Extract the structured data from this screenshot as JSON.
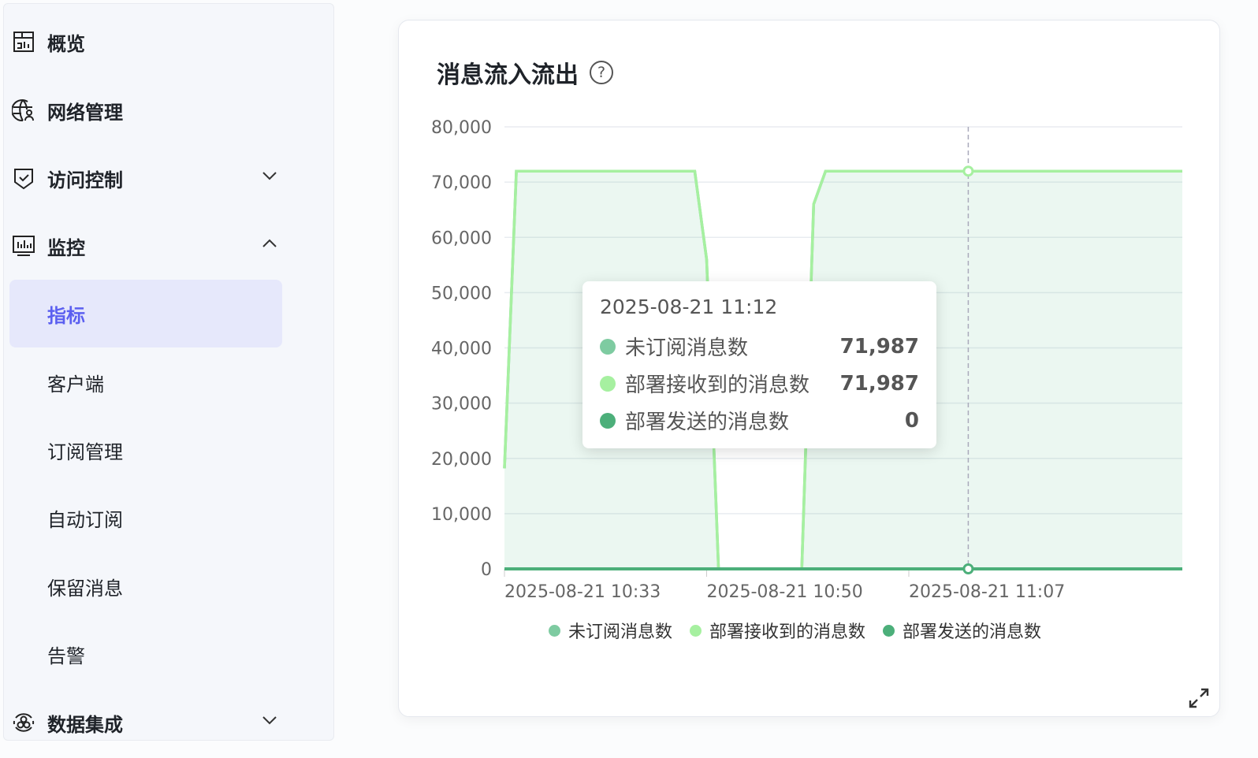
{
  "sidebar": {
    "items": [
      {
        "label": "概览",
        "icon": "dashboard-icon"
      },
      {
        "label": "网络管理",
        "icon": "globe-user-icon"
      },
      {
        "label": "访问控制",
        "icon": "shield-check-icon",
        "chevron": "down"
      },
      {
        "label": "监控",
        "icon": "monitor-chart-icon",
        "chevron": "up"
      },
      {
        "label": "指标",
        "active": true
      },
      {
        "label": "客户端"
      },
      {
        "label": "订阅管理"
      },
      {
        "label": "自动订阅"
      },
      {
        "label": "保留消息"
      },
      {
        "label": "告警"
      },
      {
        "label": "数据集成",
        "icon": "integration-icon",
        "chevron": "down"
      }
    ]
  },
  "card": {
    "title": "消息流入流出",
    "help_icon": "?"
  },
  "tooltip": {
    "time": "2025-08-21 11:12",
    "rows": [
      {
        "label": "未订阅消息数",
        "value": "71,987",
        "color": "#7ecba1"
      },
      {
        "label": "部署接收到的消息数",
        "value": "71,987",
        "color": "#a6f0a0"
      },
      {
        "label": "部署发送的消息数",
        "value": "0",
        "color": "#4caf7a"
      }
    ]
  },
  "chart_data": {
    "type": "area",
    "title": "消息流入流出",
    "ylim": [
      0,
      80000
    ],
    "yticks": [
      "0",
      "10,000",
      "20,000",
      "30,000",
      "40,000",
      "50,000",
      "60,000",
      "70,000",
      "80,000"
    ],
    "xtick_labels": [
      "2025-08-21 10:33",
      "2025-08-21 10:50",
      "2025-08-21 11:07"
    ],
    "x_start": "10:33",
    "x_step_minutes": 1,
    "series": [
      {
        "name": "未订阅消息数",
        "color": "#7ecba1",
        "values": [
          18200,
          71987,
          71987,
          71987,
          71987,
          71987,
          71987,
          71987,
          71987,
          71987,
          71987,
          71987,
          71987,
          71987,
          71987,
          71987,
          71987,
          56000,
          0,
          0,
          0,
          0,
          0,
          0,
          0,
          0,
          66000,
          71987,
          71987,
          71987,
          71987,
          71987,
          71987,
          71987,
          71987,
          71987,
          71987,
          71987,
          71987,
          71987,
          71987,
          71987,
          71987,
          71987,
          71987,
          71987,
          71987,
          71987,
          71987,
          71987,
          71987,
          71987,
          71987,
          71987,
          71987,
          71987,
          71987,
          71987
        ]
      },
      {
        "name": "部署接收到的消息数",
        "color": "#a6f0a0",
        "values": [
          18200,
          71987,
          71987,
          71987,
          71987,
          71987,
          71987,
          71987,
          71987,
          71987,
          71987,
          71987,
          71987,
          71987,
          71987,
          71987,
          71987,
          56000,
          0,
          0,
          0,
          0,
          0,
          0,
          0,
          0,
          66000,
          71987,
          71987,
          71987,
          71987,
          71987,
          71987,
          71987,
          71987,
          71987,
          71987,
          71987,
          71987,
          71987,
          71987,
          71987,
          71987,
          71987,
          71987,
          71987,
          71987,
          71987,
          71987,
          71987,
          71987,
          71987,
          71987,
          71987,
          71987,
          71987,
          71987,
          71987
        ]
      },
      {
        "name": "部署发送的消息数",
        "color": "#4caf7a",
        "values": [
          0,
          0,
          0,
          0,
          0,
          0,
          0,
          0,
          0,
          0,
          0,
          0,
          0,
          0,
          0,
          0,
          0,
          0,
          0,
          0,
          0,
          0,
          0,
          0,
          0,
          0,
          0,
          0,
          0,
          0,
          0,
          0,
          0,
          0,
          0,
          0,
          0,
          0,
          0,
          0,
          0,
          0,
          0,
          0,
          0,
          0,
          0,
          0,
          0,
          0,
          0,
          0,
          0,
          0,
          0,
          0,
          0,
          0
        ]
      }
    ],
    "highlight_index": 39,
    "legend": "bottom",
    "grid": true
  }
}
